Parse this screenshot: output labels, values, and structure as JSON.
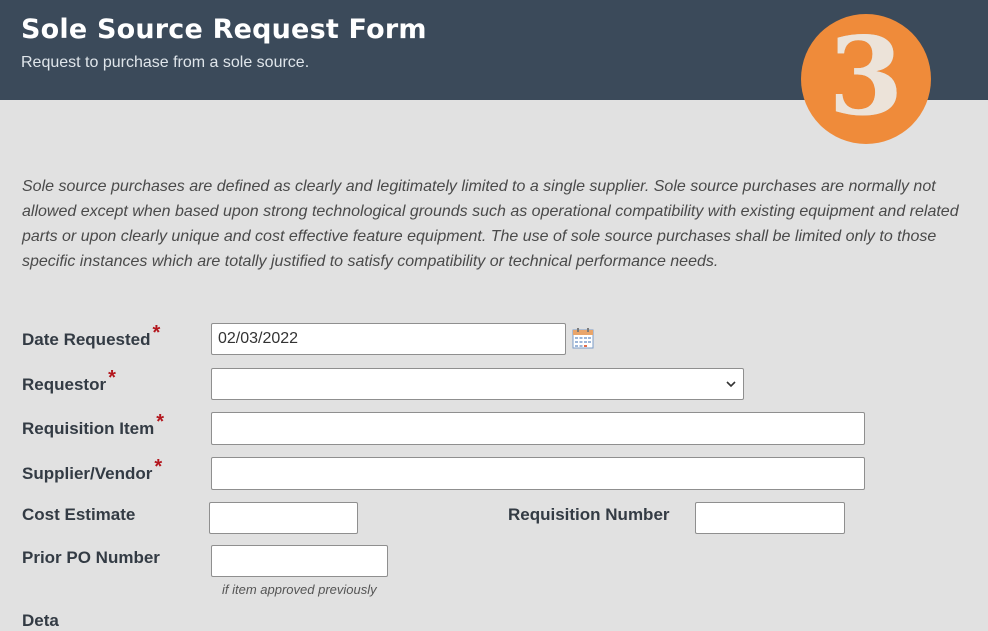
{
  "header": {
    "title": "Sole Source Request Form",
    "subtitle": "Request to purchase from a sole source.",
    "step_number": "3",
    "bar_color": "#3b4a5a",
    "badge_color": "#ef8b3a"
  },
  "intro_text": "Sole source purchases are defined as clearly and legitimately limited to a single supplier. Sole source purchases are normally not allowed except when based upon strong technological grounds such as operational compatibility with existing equipment and related parts or upon clearly unique and cost effective feature equipment. The use of sole source purchases shall be limited only to those specific instances which are totally justified to satisfy compatibility or technical performance needs.",
  "form": {
    "required_marker": "*",
    "date_requested": {
      "label": "Date Requested",
      "value": "02/03/2022",
      "icon": "calendar-icon"
    },
    "requestor": {
      "label": "Requestor",
      "value": "",
      "icon": "chevron-down-icon"
    },
    "requisition_item": {
      "label": "Requisition Item",
      "value": ""
    },
    "supplier_vendor": {
      "label": "Supplier/Vendor",
      "value": ""
    },
    "cost_estimate": {
      "label": "Cost Estimate",
      "value": ""
    },
    "requisition_number": {
      "label": "Requisition Number",
      "value": ""
    },
    "prior_po_number": {
      "label": "Prior PO Number",
      "value": "",
      "hint": "if item approved previously"
    },
    "next_label_partial": "Deta"
  },
  "colors": {
    "background": "#e1e1e1",
    "required": "#b3161d",
    "label_text": "#333b44"
  }
}
